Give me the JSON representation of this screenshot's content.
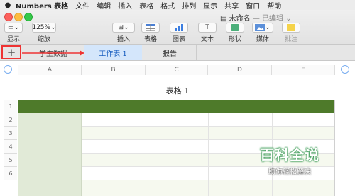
{
  "menubar": {
    "app_name": "Numbers 表格",
    "items": [
      "文件",
      "编辑",
      "插入",
      "表格",
      "格式",
      "排列",
      "显示",
      "共享",
      "窗口",
      "帮助"
    ]
  },
  "window": {
    "doc_name": "未命名",
    "doc_status": "— 已编辑"
  },
  "toolbar": {
    "view_label": "显示",
    "zoom_value": "125%",
    "zoom_label": "缩放",
    "insert_label": "插入",
    "table_label": "表格",
    "chart_label": "图表",
    "text_label": "文本",
    "shape_label": "形状",
    "media_label": "媒体",
    "comment_label": "批注"
  },
  "tabs": {
    "add": "+",
    "items": [
      "学生数据",
      "工作表 1",
      "报告"
    ],
    "active_index": 1
  },
  "sheet": {
    "columns": [
      "A",
      "B",
      "C",
      "D",
      "E"
    ],
    "table_title": "表格 1",
    "rows": [
      "1",
      "2",
      "3",
      "4",
      "5",
      "6"
    ]
  },
  "colors": {
    "header_row": "#4e7a2a",
    "header_col": "#e1ead7",
    "alt_row": "#f6f9ef",
    "highlight": "#e33333",
    "active_tab": "#d4e6fb"
  },
  "watermark": {
    "main": "百科全说",
    "sub": "助你轻松解决"
  }
}
